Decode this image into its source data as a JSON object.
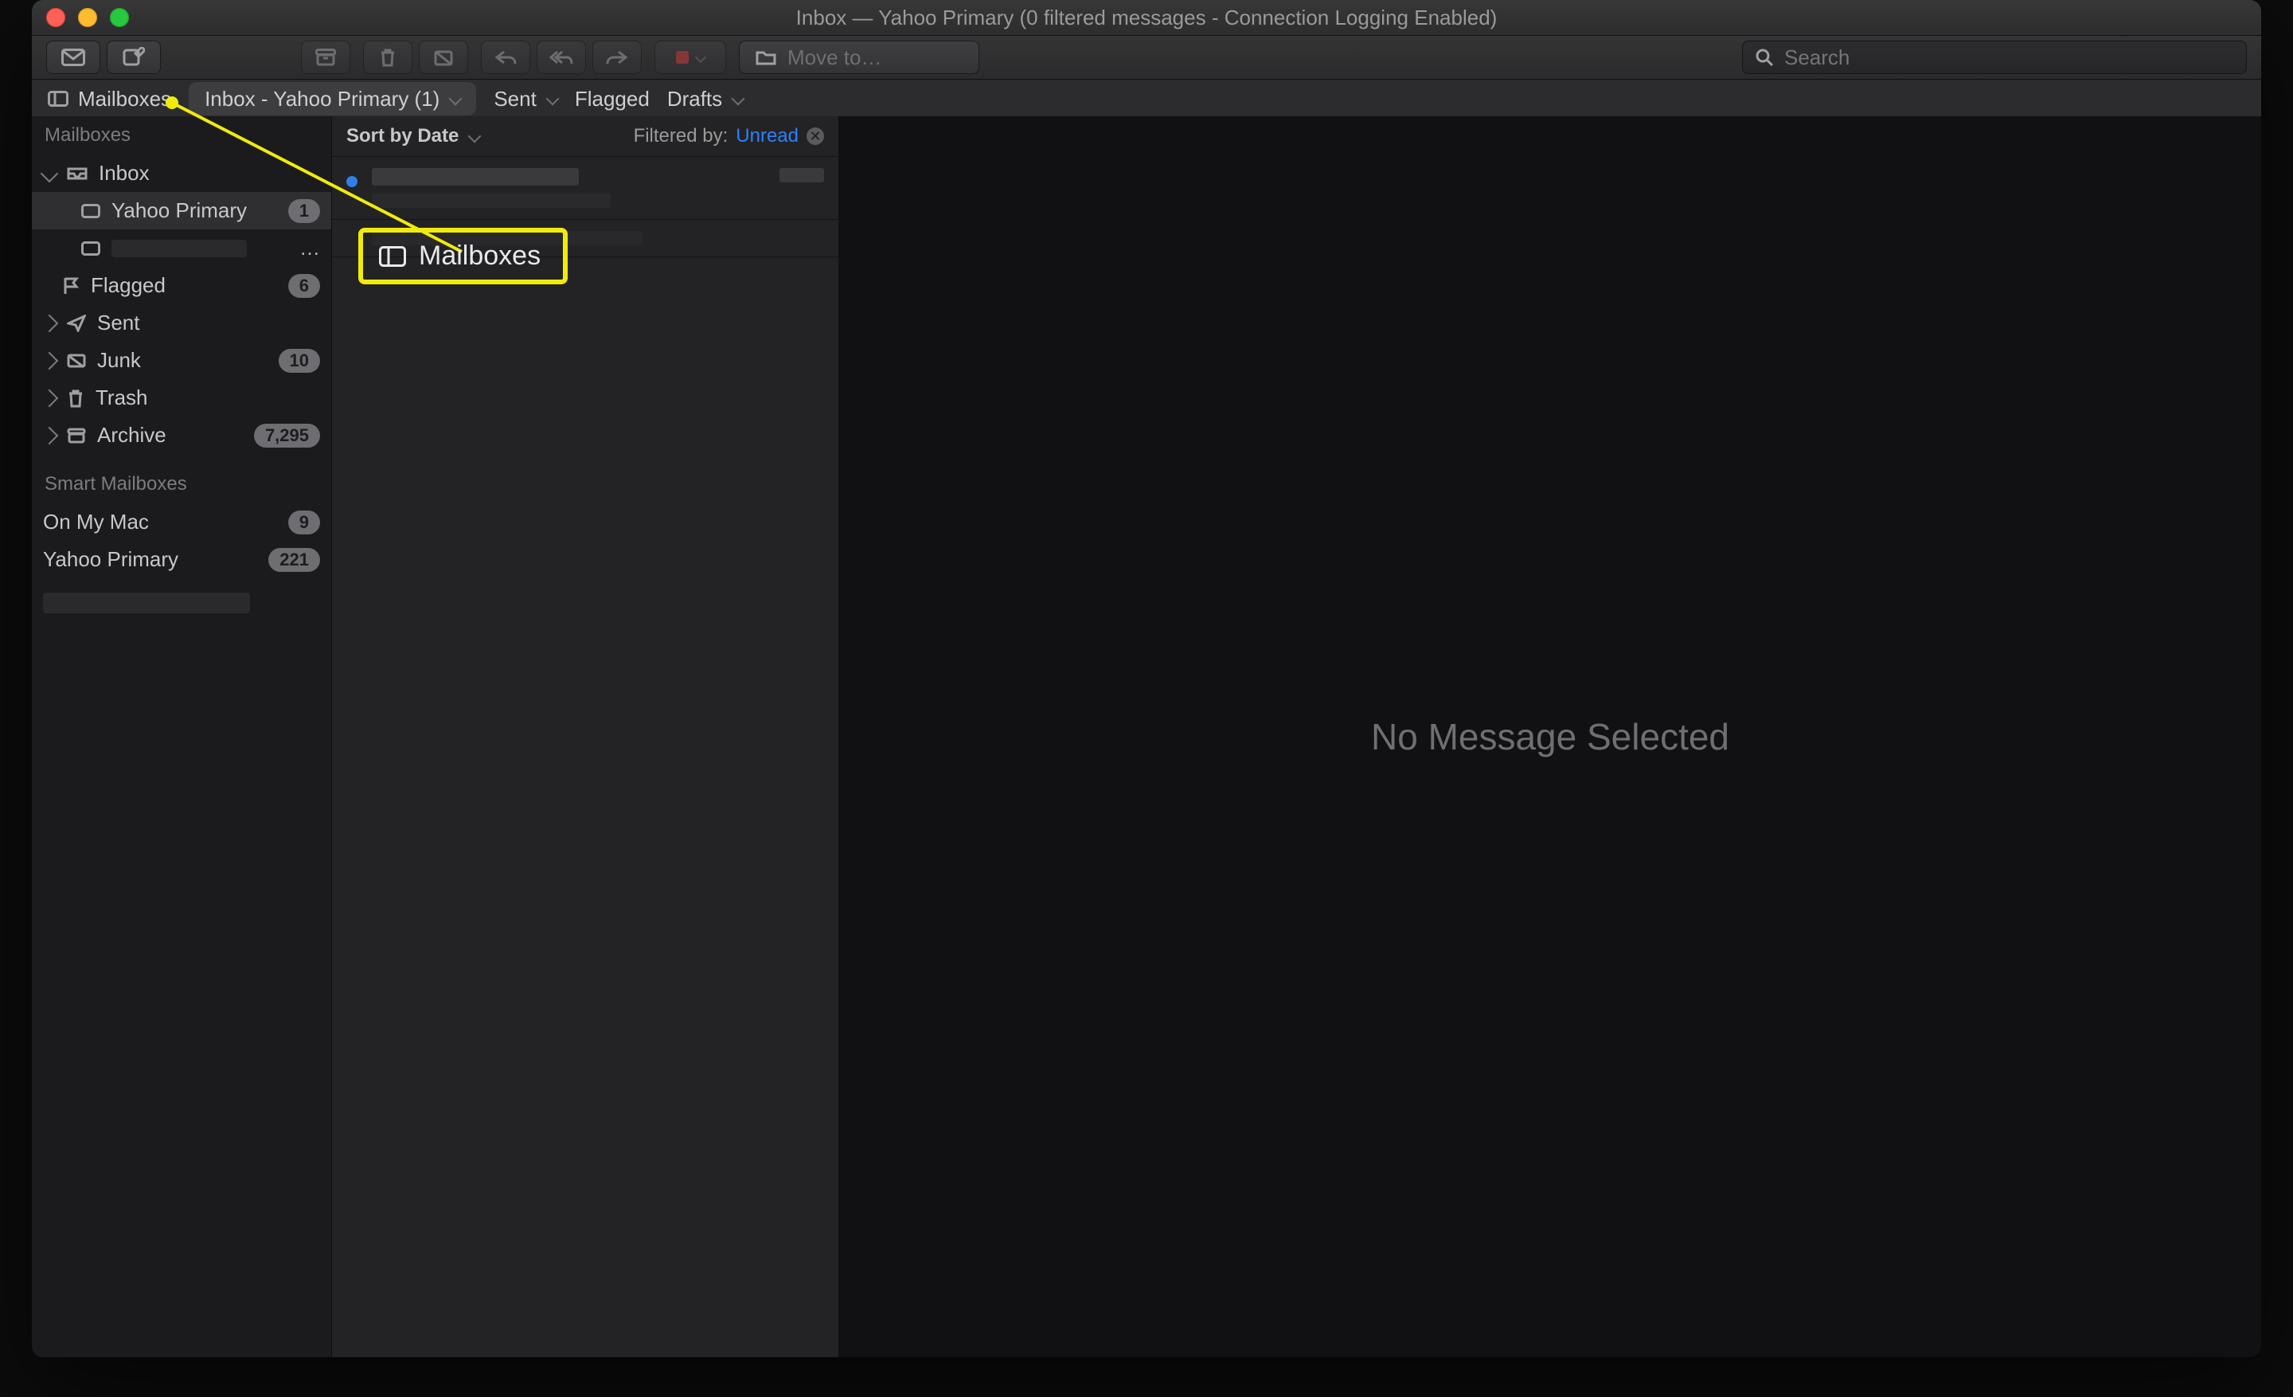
{
  "window": {
    "title": "Inbox — Yahoo Primary (0 filtered messages - Connection Logging Enabled)"
  },
  "toolbar": {
    "get_mail_label": "Get Mail",
    "compose_label": "Compose",
    "moveto_placeholder": "Move to…",
    "search_placeholder": "Search"
  },
  "favorites": {
    "mailboxes_label": "Mailboxes",
    "inbox_pill": "Inbox - Yahoo Primary (1)",
    "sent": "Sent",
    "flagged": "Flagged",
    "drafts": "Drafts"
  },
  "sidebar": {
    "section_mailboxes": "Mailboxes",
    "section_smart": "Smart Mailboxes",
    "inbox": "Inbox",
    "yahoo_primary": "Yahoo Primary",
    "yahoo_primary_count": "1",
    "redacted_account": " ",
    "redacted_ellipsis": "…",
    "flagged": "Flagged",
    "flagged_count": "6",
    "sent": "Sent",
    "junk": "Junk",
    "junk_count": "10",
    "trash": "Trash",
    "archive": "Archive",
    "archive_count": "7,295",
    "smart_onmymac": "On My Mac",
    "smart_onmymac_count": "9",
    "smart_yahoo": "Yahoo Primary",
    "smart_yahoo_count": "221"
  },
  "list": {
    "sort_label": "Sort by Date",
    "filtered_by": "Filtered by:",
    "filter_value": "Unread"
  },
  "reader": {
    "no_message": "No Message Selected"
  },
  "callout": {
    "label": "Mailboxes"
  }
}
